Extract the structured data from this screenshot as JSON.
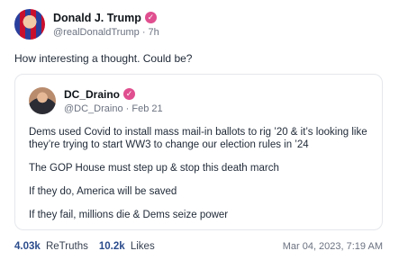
{
  "post": {
    "author": {
      "display_name": "Donald J. Trump",
      "handle": "@realDonaldTrump",
      "time_ago": "7h",
      "verified_color": "#e04f8f"
    },
    "text": "How interesting a thought. Could be?",
    "quote": {
      "author": {
        "display_name": "DC_Draino",
        "handle": "@DC_Draino",
        "date": "Feb 21"
      },
      "paragraphs": [
        "Dems used Covid to install mass mail-in ballots to rig ’20 & it’s looking like they’re trying to start WW3 to change our election rules in ’24",
        "The GOP House must step up & stop this death march",
        "If they do, America will be saved",
        "If they fail, millions die & Dems seize power"
      ]
    },
    "stats": {
      "retruths_count": "4.03k",
      "retruths_label": "ReTruths",
      "likes_count": "10.2k",
      "likes_label": "Likes"
    },
    "timestamp": "Mar 04, 2023, 7:19 AM"
  }
}
